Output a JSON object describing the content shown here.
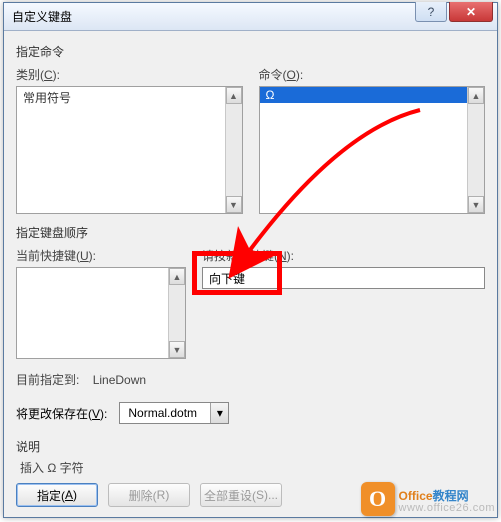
{
  "titlebar": {
    "title": "自定义键盘",
    "help": "?",
    "close": "✕"
  },
  "section1": {
    "label": "指定命令"
  },
  "category": {
    "label_pre": "类别(",
    "label_u": "C",
    "label_post": "):",
    "item": "常用符号"
  },
  "command": {
    "label_pre": "命令(",
    "label_u": "O",
    "label_post": "):",
    "selected": "Ω"
  },
  "section2": {
    "label": "指定键盘顺序"
  },
  "current": {
    "label_pre": "当前快捷键(",
    "label_u": "U",
    "label_post": "):"
  },
  "newkey": {
    "label_pre": "请按新快捷键(",
    "label_u": "N",
    "label_post": "):",
    "value": "向下键"
  },
  "assigned": {
    "label": "目前指定到:",
    "value": "LineDown"
  },
  "savein": {
    "label_pre": "将更改保存在(",
    "label_u": "V",
    "label_post": "):",
    "value": "Normal.dotm"
  },
  "desc": {
    "label": "说明",
    "text": "插入 Ω 字符"
  },
  "buttons": {
    "assign_pre": "指定(",
    "assign_u": "A",
    "assign_post": ")",
    "remove_pre": "删除(",
    "remove_u": "R",
    "remove_post": ")",
    "reset_pre": "全部重设(",
    "reset_u": "S",
    "reset_post": ")..."
  },
  "scrollbar": {
    "up": "▲",
    "down": "▼"
  },
  "watermark": {
    "icon": "O",
    "brand1": "Office",
    "brand2": "教程网",
    "url": "www.office26.com"
  }
}
